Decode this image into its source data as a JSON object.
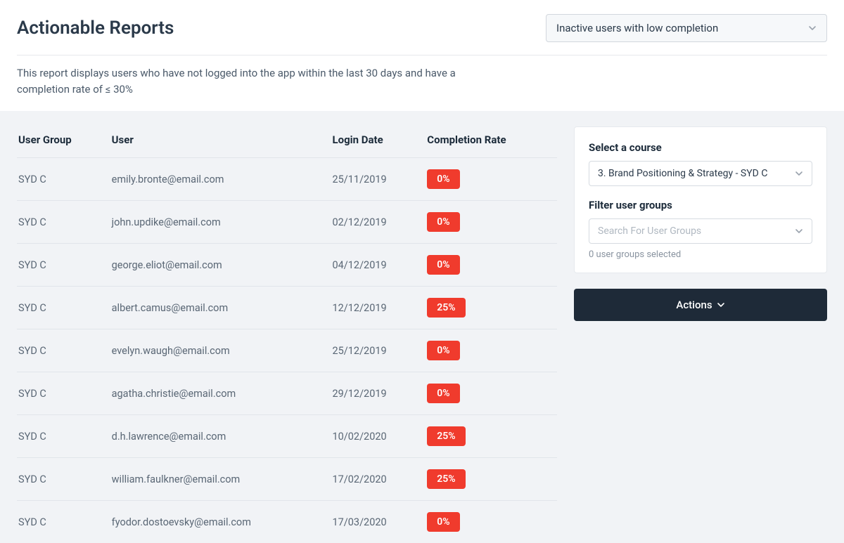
{
  "header": {
    "title": "Actionable Reports",
    "report_select_value": "Inactive users with low completion"
  },
  "description": "This report displays users who have not logged into the app within the last 30 days and have a completion rate of ≤ 30%",
  "table": {
    "columns": {
      "group": "User Group",
      "user": "User",
      "login": "Login Date",
      "completion": "Completion Rate"
    },
    "rows": [
      {
        "group": "SYD C",
        "user": "emily.bronte@email.com",
        "login": "25/11/2019",
        "completion": "0%"
      },
      {
        "group": "SYD C",
        "user": "john.updike@email.com",
        "login": "02/12/2019",
        "completion": "0%"
      },
      {
        "group": "SYD C",
        "user": "george.eliot@email.com",
        "login": "04/12/2019",
        "completion": "0%"
      },
      {
        "group": "SYD C",
        "user": "albert.camus@email.com",
        "login": "12/12/2019",
        "completion": "25%"
      },
      {
        "group": "SYD C",
        "user": "evelyn.waugh@email.com",
        "login": "25/12/2019",
        "completion": "0%"
      },
      {
        "group": "SYD C",
        "user": "agatha.christie@email.com",
        "login": "29/12/2019",
        "completion": "0%"
      },
      {
        "group": "SYD C",
        "user": "d.h.lawrence@email.com",
        "login": "10/02/2020",
        "completion": "25%"
      },
      {
        "group": "SYD C",
        "user": "william.faulkner@email.com",
        "login": "17/02/2020",
        "completion": "25%"
      },
      {
        "group": "SYD C",
        "user": "fyodor.dostoevsky@email.com",
        "login": "17/03/2020",
        "completion": "0%"
      }
    ]
  },
  "side": {
    "course_label": "Select a course",
    "course_value": "3. Brand Positioning & Strategy - SYD C",
    "groups_label": "Filter user groups",
    "groups_placeholder": "Search For User Groups",
    "groups_helper": "0 user groups selected",
    "actions_label": "Actions"
  },
  "colors": {
    "badge_bg": "#f03b2d",
    "actions_bg": "#1e2a38",
    "panel_bg": "#f1f3f6"
  }
}
